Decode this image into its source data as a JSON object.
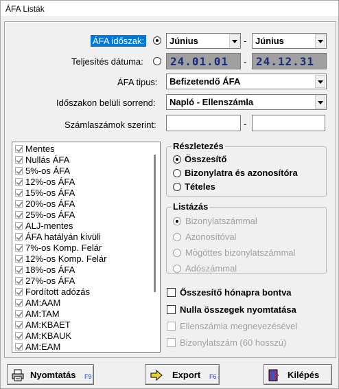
{
  "window": {
    "title": "ÁFA Listák"
  },
  "filters": {
    "period_label": "ÁFA időszak:",
    "period_from": "Június",
    "period_to": "Június",
    "dash": "-",
    "date_label": "Teljesítés dátuma:",
    "date_from": "24.01.01",
    "date_to": "24.12.31",
    "vat_type_label": "ÁFA tipus:",
    "vat_type_value": "Befizetendő ÁFA",
    "order_label": "Időszakon belüli sorrend:",
    "order_value": "Napló - Ellenszámla",
    "invoice_label": "Számlaszámok szerint:"
  },
  "vat_list": [
    "Mentes",
    "Nullás ÁFA",
    "5%-os ÁFA",
    "12%-os ÁFA",
    "15%-os ÁFA",
    "20%-os ÁFA",
    "25%-os ÁFA",
    "ALJ-mentes",
    "ÁFA hatályán kívüli",
    "7%-os Komp. Felár",
    "12%-os Komp. Felár",
    "18%-os ÁFA",
    "27%-os ÁFA",
    "Fordított adózás",
    "AM:AAM",
    "AM:TAM",
    "AM:KBAET",
    "AM:KBAUK",
    "AM:EAM"
  ],
  "detail": {
    "legend": "Részletezés",
    "options": [
      "Összesítő",
      "Bizonylatra és azonosítóra",
      "Tételes"
    ],
    "selected": "Összesítő"
  },
  "listing": {
    "legend": "Listázás",
    "options": [
      "Bizonylatszámmal",
      "Azonosítóval",
      "Mögöttes bizonylatszámmal",
      "Adószámmal"
    ]
  },
  "checkboxes": {
    "monthly": "Összesítő hónapra bontva",
    "zero": "Nulla összegek nyomtatása",
    "counter": "Ellenszámla megnevezésével",
    "docnum": "Bizonylatszám (60 hosszú)"
  },
  "buttons": {
    "print": {
      "label": "Nyomtatás",
      "key": "F9"
    },
    "export": {
      "label": "Export",
      "key": "F6"
    },
    "exit": {
      "label": "Kilépés"
    }
  },
  "colors": {
    "date_bg": "#a0a0a0",
    "date_text": "#1a2a7a",
    "selection": "#0078d7",
    "hotkey": "#1a3ad0"
  }
}
